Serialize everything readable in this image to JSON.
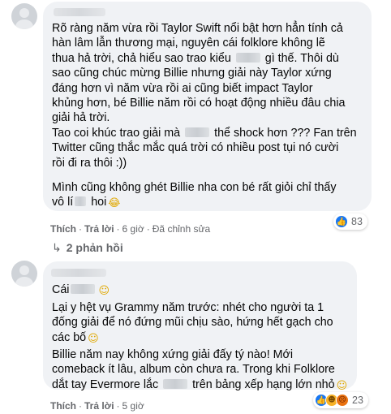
{
  "comment1": {
    "lines": [
      "Rõ ràng năm vừa rồi Taylor Swift nổi bật hơn hẳn tính cả",
      "hàn lâm lẫn thương mại, nguyên cái folklore không lẽ",
      [
        "thua hả trời, chả hiểu sao trao kiểu ",
        " gì thế. Thôi dù"
      ],
      "sao cũng chúc mừng Billie nhưng giải này Taylor xứng",
      "đáng hơn vì năm vừa rồi ai cũng biết impact Taylor",
      "khủng hơn, bé Billie năm rồi có hoạt động nhiều đâu chia",
      "giải hả trời.",
      [
        "Tao coi khúc trao giải mà ",
        " thể shock hơn ??? Fan trên"
      ],
      "Twitter cũng thắc mắc quá trời có nhiều post tụi nó cười",
      "rồi đi ra thôi :))"
    ],
    "line2_a": "Mình cũng không ghét Billie nha con bé rất giỏi chỉ thấy",
    "line2_b": [
      "vô lí",
      " hoi"
    ],
    "emoji_laugh": "😂",
    "action_like": "Thích",
    "action_reply": "Trả lời",
    "time": "6 giờ",
    "edited": "Đã chỉnh sửa",
    "reaction_count": "83",
    "reaction_icons": [
      "like-icon"
    ]
  },
  "replies_link": "2 phản hồi",
  "comment2": {
    "l1": "Cái",
    "p2": [
      "Lại y hệt vụ Grammy năm trước: nhét cho người ta 1",
      "đống giải để nó đứng mũi chịu sào, hứng hết gạch cho",
      "các bố"
    ],
    "p3": [
      "Billie năm nay không xứng giải đấy tý nào! Mới",
      "comeback ít lâu, album còn chưa ra. Trong khi Folklore",
      [
        "dắt tay Evermore lắc ",
        " trên bảng xếp hạng lớn nhỏ"
      ]
    ],
    "emoji_smile": "☺",
    "action_like": "Thích",
    "action_reply": "Trả lời",
    "time": "5 giờ",
    "reaction_count": "23",
    "reaction_icons": [
      "like-icon",
      "haha-icon",
      "angry-icon"
    ]
  },
  "colors": {
    "like": "#1877f2",
    "bubble": "#f0f2f5",
    "meta": "#65676b"
  }
}
